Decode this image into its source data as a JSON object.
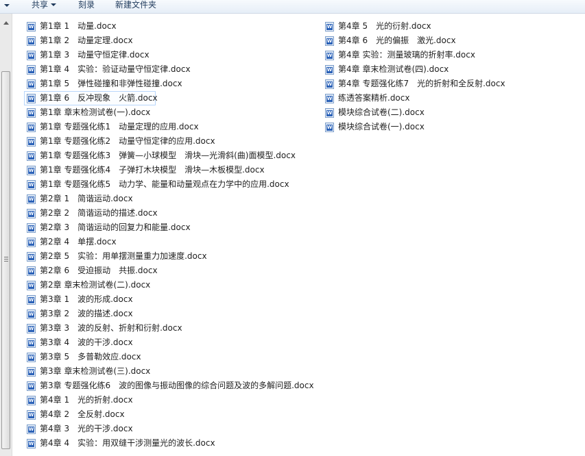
{
  "toolbar": {
    "share_label": "共享",
    "burn_label": "刻录",
    "new_folder_label": "新建文件夹"
  },
  "files_col1": [
    "第1章 1　动量.docx",
    "第1章 2　动量定理.docx",
    "第1章 3　动量守恒定律.docx",
    "第1章 4　实验：验证动量守恒定律.docx",
    "第1章 5　弹性碰撞和非弹性碰撞.docx",
    "第1章 6　反冲现象　火箭.docx",
    "第1章 章末检测试卷(一).docx",
    "第1章 专题强化练1　动量定理的应用.docx",
    "第1章 专题强化练2　动量守恒定律的应用.docx",
    "第1章 专题强化练3　弹簧—小球模型　滑块—光滑斜(曲)面模型.docx",
    "第1章 专题强化练4　子弹打木块模型　滑块—木板模型.docx",
    "第1章 专题强化练5　动力学、能量和动量观点在力学中的应用.docx",
    "第2章 1　简谐运动.docx",
    "第2章 2　简谐运动的描述.docx",
    "第2章 3　简谐运动的回复力和能量.docx",
    "第2章 4　单摆.docx",
    "第2章 5　实验：用单摆测量重力加速度.docx",
    "第2章 6　受迫振动　共振.docx",
    "第2章 章末检测试卷(二).docx",
    "第3章 1　波的形成.docx",
    "第3章 2　波的描述.docx",
    "第3章 3　波的反射、折射和衍射.docx",
    "第3章 4　波的干涉.docx",
    "第3章 5　多普勒效应.docx",
    "第3章 章末检测试卷(三).docx",
    "第3章 专题强化练6　波的图像与振动图像的综合问题及波的多解问题.docx",
    "第4章 1　光的折射.docx",
    "第4章 2　全反射.docx",
    "第4章 3　光的干涉.docx",
    "第4章 4　实验：用双缝干涉测量光的波长.docx"
  ],
  "files_col2": [
    "第4章 5　光的衍射.docx",
    "第4章 6　光的偏振　激光.docx",
    "第4章 实验：测量玻璃的折射率.docx",
    "第4章 章末检测试卷(四).docx",
    "第4章 专题强化练7　光的折射和全反射.docx",
    "练透答案精析.docx",
    "模块综合试卷(二).docx",
    "模块综合试卷(一).docx"
  ],
  "icon_letter": "W",
  "colors": {
    "word_icon_blue": "#2b62b8",
    "focus_border": "#b8d6fb",
    "toolbar_text": "#1e395b"
  }
}
